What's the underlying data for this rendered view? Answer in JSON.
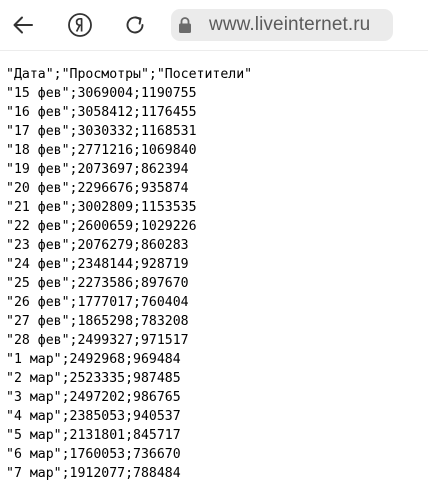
{
  "toolbar": {
    "back_icon": "arrow-left-icon",
    "yandex_icon": "yandex-logo-icon",
    "reload_icon": "reload-icon",
    "lock_icon": "lock-icon",
    "url": "www.liveinternet.ru"
  },
  "colors": {
    "text": "#000000",
    "icon": "#333333",
    "address_bg": "#ebebeb",
    "url_text": "#5b5b5b"
  },
  "csv": {
    "header": "\"Дата\";\"Просмотры\";\"Посетители\"",
    "rows": [
      "\"15 фев\";3069004;1190755",
      "\"16 фев\";3058412;1176455",
      "\"17 фев\";3030332;1168531",
      "\"18 фев\";2771216;1069840",
      "\"19 фев\";2073697;862394",
      "\"20 фев\";2296676;935874",
      "\"21 фев\";3002809;1153535",
      "\"22 фев\";2600659;1029226",
      "\"23 фев\";2076279;860283",
      "\"24 фев\";2348144;928719",
      "\"25 фев\";2273586;897670",
      "\"26 фев\";1777017;760404",
      "\"27 фев\";1865298;783208",
      "\"28 фев\";2499327;971517",
      "\"1 мар\";2492968;969484",
      "\"2 мар\";2523335;987485",
      "\"3 мар\";2497202;986765",
      "\"4 мар\";2385053;940537",
      "\"5 мар\";2131801;845717",
      "\"6 мар\";1760053;736670",
      "\"7 мар\";1912077;788484"
    ]
  }
}
